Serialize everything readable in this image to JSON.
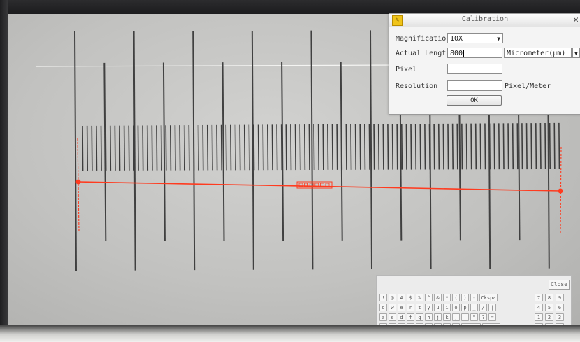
{
  "dialog": {
    "title": "Calibration",
    "close_glyph": "✕",
    "magnification_label": "Magnification",
    "magnification_value": "10X",
    "actual_length_label": "Actual Length",
    "actual_length_value": "800",
    "unit_value": "Micrometer(μm)",
    "pixel_label": "Pixel",
    "pixel_value": "",
    "resolution_label": "Resolution",
    "resolution_value": "",
    "resolution_unit": "Pixel/Meter",
    "ok_label": "OK"
  },
  "measurement_line": {
    "color": "#ff3b1f"
  },
  "keyboard": {
    "close_label": "Close",
    "rows": [
      [
        "!",
        "@",
        "#",
        "$",
        "%",
        "^",
        "&",
        "*",
        "(",
        ")",
        "-",
        "Ckspa"
      ],
      [
        "q",
        "w",
        "e",
        "r",
        "t",
        "y",
        "u",
        "i",
        "o",
        "p",
        "_",
        "/",
        "|"
      ],
      [
        "a",
        "s",
        "d",
        "f",
        "g",
        "h",
        "j",
        "k",
        ";",
        ":",
        "\"",
        "?",
        "="
      ],
      [
        "z",
        "x",
        "c",
        "v",
        "b",
        "n",
        "m",
        ",",
        "\\",
        "Space",
        "a-z"
      ]
    ],
    "numpad": [
      [
        "7",
        "8",
        "9"
      ],
      [
        "4",
        "5",
        "6"
      ],
      [
        "1",
        "2",
        "3"
      ],
      [
        "⌫",
        ".",
        "+"
      ]
    ]
  }
}
